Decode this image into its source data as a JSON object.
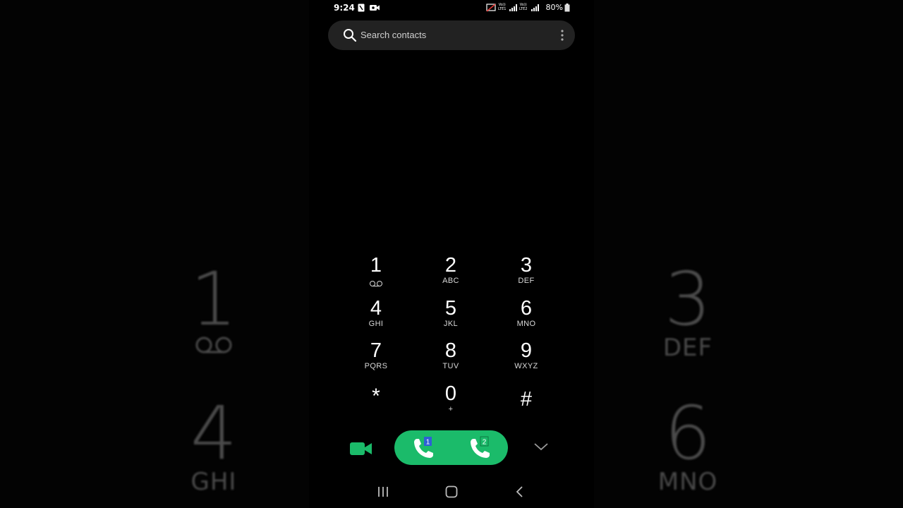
{
  "backdrop": {
    "left": [
      {
        "digit": "1",
        "letters": ""
      },
      {
        "digit": "4",
        "letters": "GHI"
      }
    ],
    "right": [
      {
        "digit": "3",
        "letters": "DEF"
      },
      {
        "digit": "6",
        "letters": "MNO"
      }
    ]
  },
  "status_bar": {
    "time": "9:24",
    "battery": "80%",
    "sim1_label": "LTE1",
    "sim2_label": "LTE2",
    "volte": "Vo))"
  },
  "search": {
    "placeholder": "Search contacts",
    "icon": "search-icon",
    "menu_icon": "more-vert-icon"
  },
  "keypad": {
    "keys": [
      {
        "digit": "1",
        "letters": ""
      },
      {
        "digit": "2",
        "letters": "ABC"
      },
      {
        "digit": "3",
        "letters": "DEF"
      },
      {
        "digit": "4",
        "letters": "GHI"
      },
      {
        "digit": "5",
        "letters": "JKL"
      },
      {
        "digit": "6",
        "letters": "MNO"
      },
      {
        "digit": "7",
        "letters": "PQRS"
      },
      {
        "digit": "8",
        "letters": "TUV"
      },
      {
        "digit": "9",
        "letters": "WXYZ"
      },
      {
        "digit": "*",
        "letters": ""
      },
      {
        "digit": "0",
        "letters": "+"
      },
      {
        "digit": "#",
        "letters": ""
      }
    ]
  },
  "actions": {
    "video_icon": "video-call-icon",
    "sim1": "1",
    "sim2": "2",
    "collapse_icon": "chevron-down-icon",
    "accent": "#1bbb6a"
  },
  "navigation": {
    "recents": "recents-icon",
    "home": "home-icon",
    "back": "back-icon"
  }
}
